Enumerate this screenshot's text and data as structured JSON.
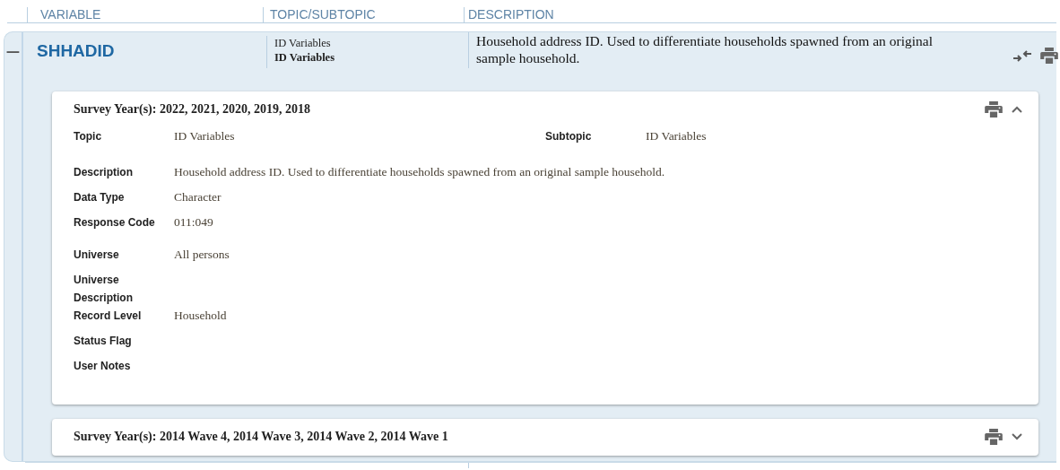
{
  "header": {
    "columns": [
      "VARIABLE",
      "TOPIC/SUBTOPIC",
      "DESCRIPTION"
    ]
  },
  "variable": {
    "expanded": true,
    "toggle": "−",
    "name": "SHHADID",
    "topic": "ID Variables",
    "subtopic": "ID Variables",
    "description": "Household address ID. Used to differentiate households spawned from an original sample household."
  },
  "cards": [
    {
      "title": "Survey Year(s): 2022, 2021, 2020, 2019, 2018",
      "expanded": true,
      "topic_label": "Topic",
      "topic": "ID Variables",
      "subtopic_label": "Subtopic",
      "subtopic": "ID Variables",
      "fields": [
        {
          "label": "Description",
          "value": "Household address ID. Used to differentiate households spawned from an original sample household."
        },
        {
          "label": "Data Type",
          "value": "Character"
        },
        {
          "label": "Response Code",
          "value": "011:049"
        },
        {
          "label": "Universe",
          "value": "All persons"
        },
        {
          "label": "Universe Description"
        },
        {
          "label": "Record Level",
          "value": "Household"
        },
        {
          "label": "Status Flag"
        },
        {
          "label": "User Notes"
        }
      ]
    },
    {
      "title": "Survey Year(s): 2014 Wave 4, 2014 Wave 3, 2014 Wave 2, 2014 Wave 1",
      "expanded": false
    }
  ]
}
